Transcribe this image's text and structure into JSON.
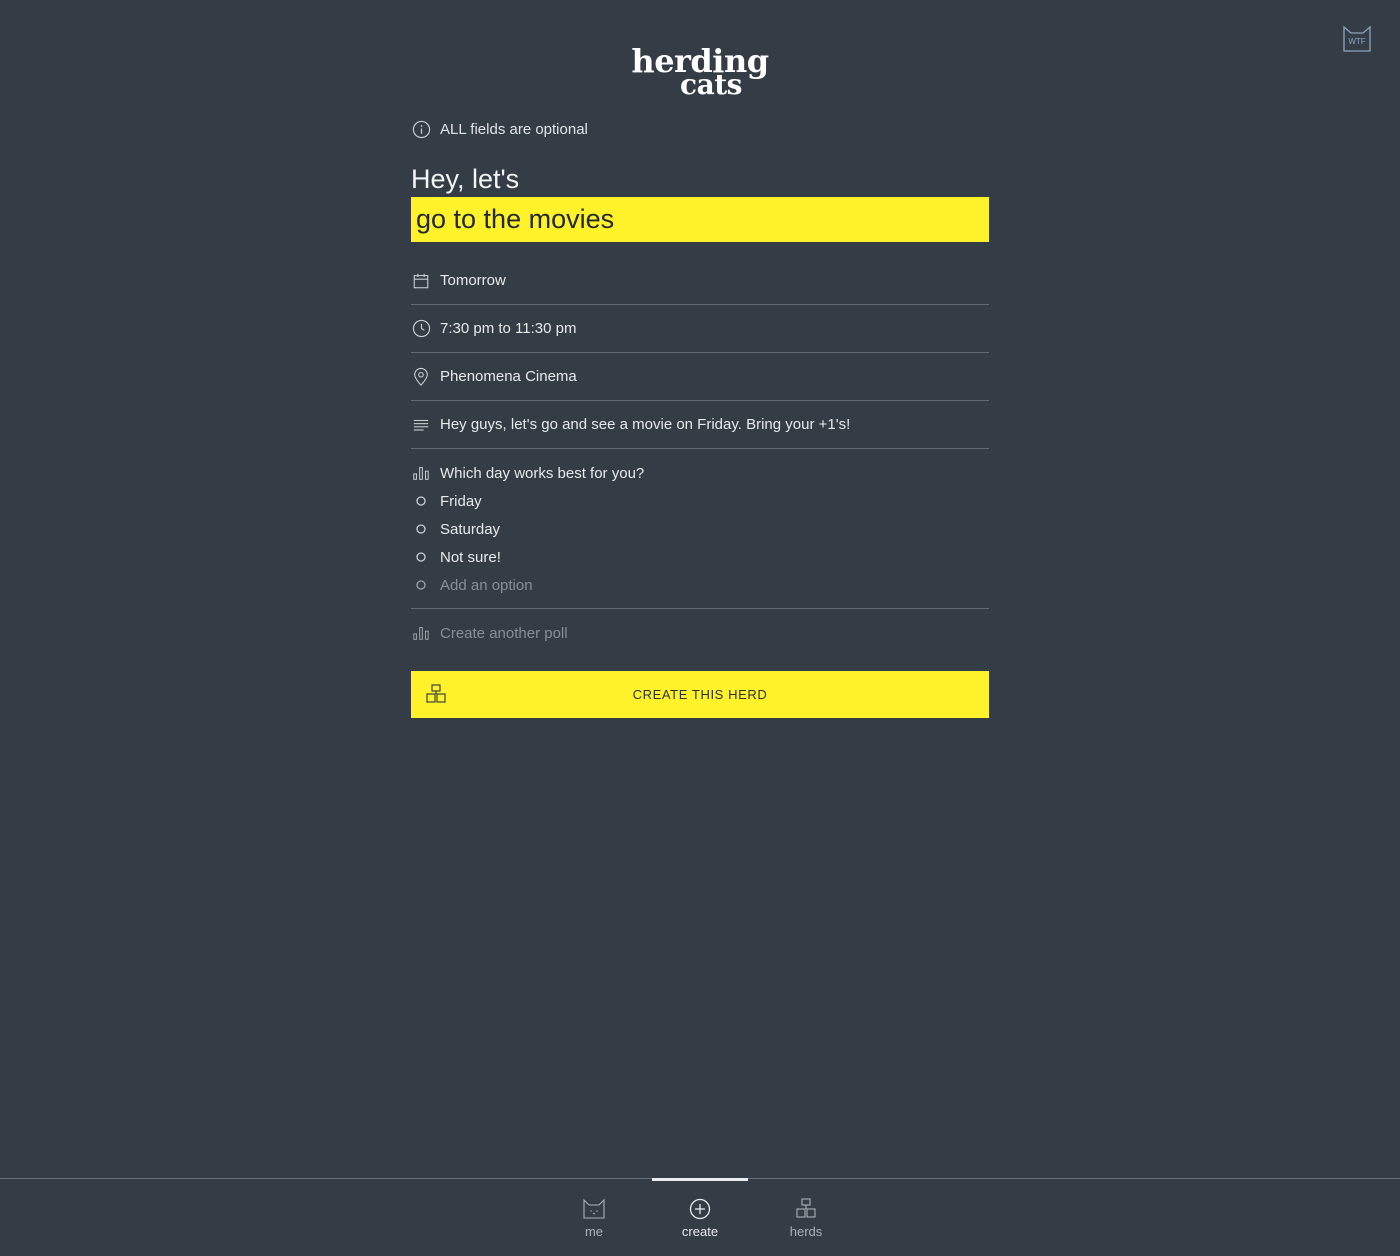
{
  "logo": {
    "line1": "herding",
    "line2": "cats"
  },
  "header": {
    "help_button_label": "WTF",
    "help_icon": "cat-face-icon"
  },
  "info": {
    "icon": "info-circle-icon",
    "text": "ALL fields are optional"
  },
  "form": {
    "heading": "Hey, let's",
    "activity_value": "go to the movies",
    "date": {
      "icon": "calendar-icon",
      "value": "Tomorrow"
    },
    "time": {
      "icon": "clock-icon",
      "value": "7:30 pm to 11:30 pm"
    },
    "location": {
      "icon": "map-pin-icon",
      "value": "Phenomena Cinema"
    },
    "description": {
      "icon": "text-lines-icon",
      "value": "Hey guys, let's go and see a movie on Friday. Bring your +1's!"
    }
  },
  "poll": {
    "icon": "bar-chart-icon",
    "question": "Which day works best for you?",
    "options": [
      "Friday",
      "Saturday",
      "Not sure!"
    ],
    "add_option_placeholder": "Add an option",
    "add_poll_label": "Create another poll"
  },
  "create_button": {
    "icon": "herd-stack-icon",
    "label": "CREATE THIS HERD"
  },
  "nav": {
    "items": [
      {
        "label": "me",
        "icon": "cat-face-icon"
      },
      {
        "label": "create",
        "icon": "plus-circle-icon",
        "active": true
      },
      {
        "label": "herds",
        "icon": "herd-stack-icon"
      }
    ]
  },
  "colors": {
    "background": "#343d45",
    "accent": "#fff22b"
  }
}
